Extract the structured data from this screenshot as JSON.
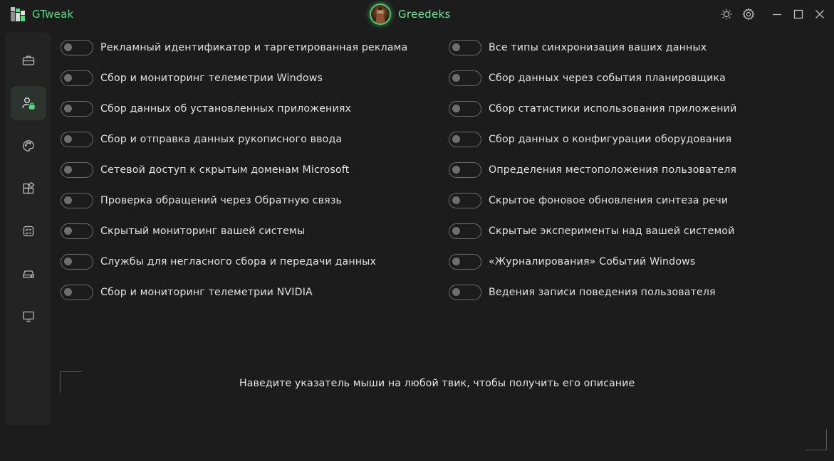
{
  "app": {
    "title": "GTweak",
    "accent": "#4ee07e"
  },
  "user": {
    "name": "Greedeks"
  },
  "window_controls": [
    "theme-icon",
    "settings-icon",
    "minimize-icon",
    "maximize-icon",
    "close-icon"
  ],
  "sidebar": {
    "items": [
      {
        "icon": "briefcase-icon",
        "active": false
      },
      {
        "icon": "user-lock-icon",
        "active": true
      },
      {
        "icon": "palette-icon",
        "active": false
      },
      {
        "icon": "apps-icon",
        "active": false
      },
      {
        "icon": "checklist-icon",
        "active": false
      },
      {
        "icon": "drive-icon",
        "active": false
      },
      {
        "icon": "monitor-icon",
        "active": false
      }
    ]
  },
  "tweaks": {
    "left": [
      {
        "label": "Рекламный идентификатор и таргетированная реклама",
        "on": false
      },
      {
        "label": "Сбор и мониторинг телеметрии Windows",
        "on": false
      },
      {
        "label": "Сбор данных об установленных приложениях",
        "on": false
      },
      {
        "label": "Сбор и отправка данных рукописного ввода",
        "on": false
      },
      {
        "label": "Сетевой доступ к скрытым доменам Microsoft",
        "on": false
      },
      {
        "label": "Проверка обращений через Обратную связь",
        "on": false
      },
      {
        "label": "Скрытый мониторинг вашей системы",
        "on": false
      },
      {
        "label": "Службы для негласного сбора и передачи данных",
        "on": false
      },
      {
        "label": "Сбор и мониторинг телеметрии NVIDIA",
        "on": false
      }
    ],
    "right": [
      {
        "label": "Все типы синхронизация ваших данных",
        "on": false
      },
      {
        "label": "Сбор данных через события планировщика",
        "on": false
      },
      {
        "label": "Сбор статистики использования приложений",
        "on": false
      },
      {
        "label": "Сбор данных о конфигурации оборудования",
        "on": false
      },
      {
        "label": "Определения местоположения пользователя",
        "on": false
      },
      {
        "label": "Скрытое фоновое обновления синтеза речи",
        "on": false
      },
      {
        "label": "Скрытые эксперименты над вашей системой",
        "on": false
      },
      {
        "label": "«Журналирования» Событий Windows",
        "on": false
      },
      {
        "label": "Ведения записи поведения пользователя",
        "on": false
      }
    ]
  },
  "hint": {
    "text": "Наведите указатель мыши на любой твик, чтобы получить его описание"
  }
}
